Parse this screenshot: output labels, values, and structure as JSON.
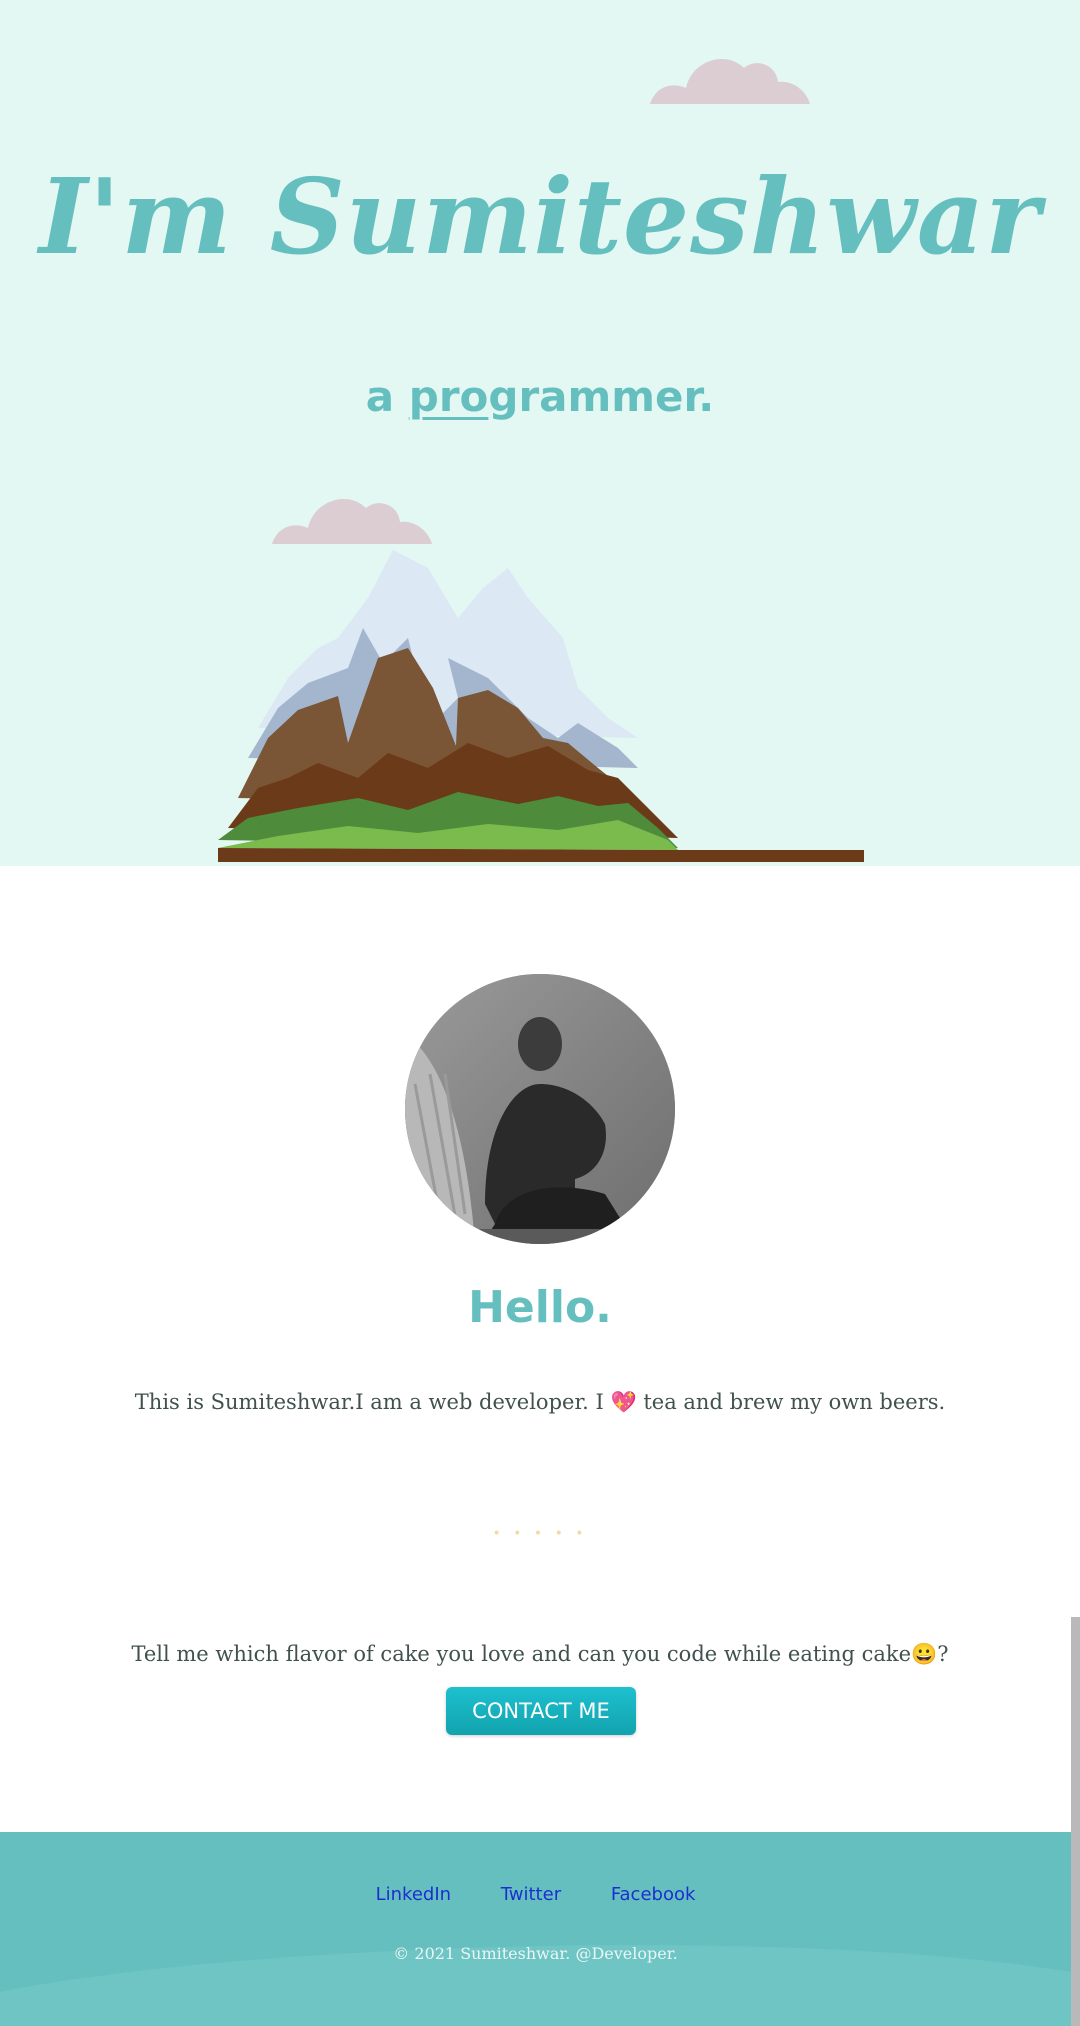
{
  "hero": {
    "title": "I'm Sumiteshwar",
    "subtitle_prefix": "a ",
    "subtitle_underlined": "pro",
    "subtitle_rest": "grammer.",
    "bg_color": "#e3f7f3"
  },
  "about": {
    "heading": "Hello.",
    "intro_before": "This is Sumiteshwar.I am a web developer. I ",
    "intro_emoji": "💖",
    "intro_after": " tea and brew my own beers.",
    "divider": "• • • • •"
  },
  "contact": {
    "prompt_before": "Tell me which flavor of cake you love and can you code while eating cake",
    "prompt_emoji": "😀",
    "prompt_after": "?",
    "button_label": "CONTACT ME"
  },
  "footer": {
    "links": [
      "LinkedIn",
      "Twitter",
      "Facebook"
    ],
    "copyright": "© 2021 Sumiteshwar. @Developer."
  },
  "colors": {
    "accent": "#66bfbf",
    "text": "#40514e",
    "button": "#11a3ae",
    "link": "#1b2fd1",
    "cloud": "#dccdd2"
  }
}
